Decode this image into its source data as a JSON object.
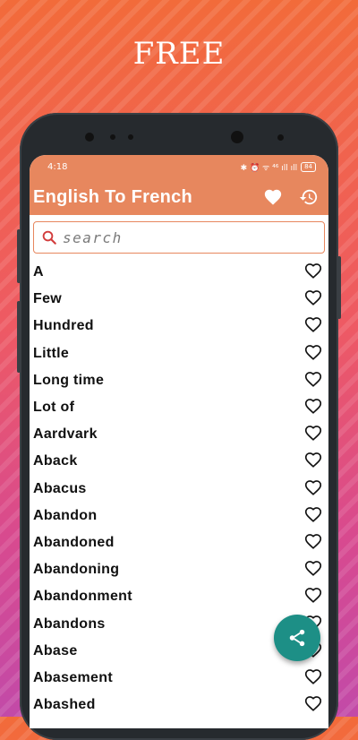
{
  "promo": {
    "label": "FREE"
  },
  "status_bar": {
    "time": "4:18",
    "icons_text": "✱ ⏰ ᯤ ⁴⁶ ıll ıll",
    "battery": "84"
  },
  "app_bar": {
    "title": "English To French",
    "favorites_icon": "heart-filled-icon",
    "history_icon": "history-icon"
  },
  "search": {
    "placeholder": "search",
    "value": ""
  },
  "words": [
    "A",
    "Few",
    "Hundred",
    "Little",
    "Long time",
    "Lot of",
    "Aardvark",
    "Aback",
    "Abacus",
    "Abandon",
    "Abandoned",
    "Abandoning",
    "Abandonment",
    "Abandons",
    "Abase",
    "Abasement",
    "Abashed"
  ],
  "fab": {
    "icon": "share-icon"
  },
  "colors": {
    "accent": "#e7875e",
    "fab": "#1d8f86"
  }
}
